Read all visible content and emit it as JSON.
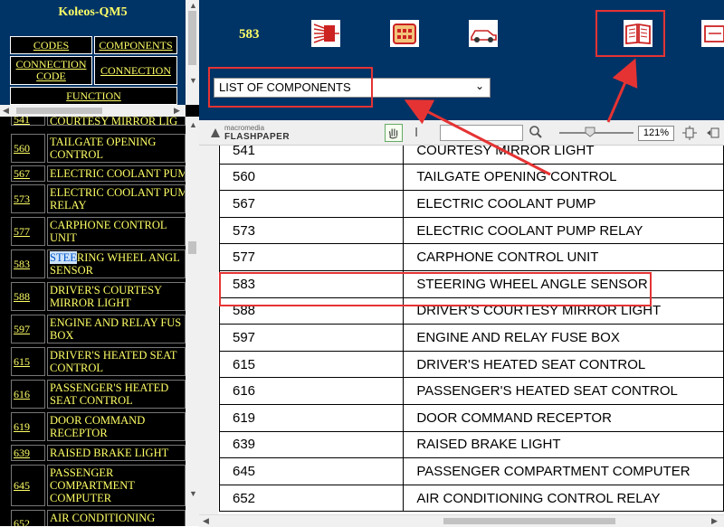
{
  "left_panel": {
    "title": "Koleos-QM5",
    "menu": {
      "codes": "CODES",
      "components": "COMPONENTS",
      "connection_code": "CONNECTION\nCODE",
      "connection": "CONNECTION",
      "function": "FUNCTION"
    },
    "list": [
      {
        "code": "541",
        "label": "COURTESY MIRROR LIG"
      },
      {
        "code": "560",
        "label": "TAILGATE OPENING\nCONTROL"
      },
      {
        "code": "567",
        "label": "ELECTRIC COOLANT PUM"
      },
      {
        "code": "573",
        "label": "ELECTRIC COOLANT PUM\nRELAY"
      },
      {
        "code": "577",
        "label": "CARPHONE CONTROL\nUNIT"
      },
      {
        "code": "583",
        "label_highlight": "STEE",
        "label_rest": "RING WHEEL ANGL",
        "label_line2": "SENSOR"
      },
      {
        "code": "588",
        "label": "DRIVER'S COURTESY\nMIRROR LIGHT"
      },
      {
        "code": "597",
        "label": "ENGINE AND RELAY FUS\nBOX"
      },
      {
        "code": "615",
        "label": "DRIVER'S HEATED SEAT\nCONTROL"
      },
      {
        "code": "616",
        "label": "PASSENGER'S HEATED\nSEAT CONTROL"
      },
      {
        "code": "619",
        "label": "DOOR COMMAND\nRECEPTOR"
      },
      {
        "code": "639",
        "label": "RAISED BRAKE LIGHT"
      },
      {
        "code": "645",
        "label": "PASSENGER\nCOMPARTMENT\nCOMPUTER"
      },
      {
        "code": "652",
        "label": "AIR CONDITIONING"
      }
    ]
  },
  "topbar": {
    "code": "583",
    "select": {
      "value": "LIST OF COMPONENTS"
    },
    "icons": [
      "wiring-icon",
      "connector-icon",
      "car-icon",
      "book-icon",
      "page-icon"
    ]
  },
  "flashpaper": {
    "brand_top": "macromedia",
    "brand_main": "FLASHPAPER",
    "zoom": "121%"
  },
  "components_table": {
    "rows": [
      [
        "541",
        "COURTESY MIRROR LIGHT"
      ],
      [
        "560",
        "TAILGATE OPENING CONTROL"
      ],
      [
        "567",
        "ELECTRIC COOLANT PUMP"
      ],
      [
        "573",
        "ELECTRIC COOLANT PUMP RELAY"
      ],
      [
        "577",
        "CARPHONE CONTROL UNIT"
      ],
      [
        "583",
        "STEERING WHEEL ANGLE SENSOR"
      ],
      [
        "588",
        "DRIVER'S COURTESY MIRROR LIGHT"
      ],
      [
        "597",
        "ENGINE AND RELAY FUSE BOX"
      ],
      [
        "615",
        "DRIVER'S HEATED SEAT CONTROL"
      ],
      [
        "616",
        "PASSENGER'S HEATED SEAT CONTROL"
      ],
      [
        "619",
        "DOOR COMMAND RECEPTOR"
      ],
      [
        "639",
        "RAISED BRAKE LIGHT"
      ],
      [
        "645",
        "PASSENGER COMPARTMENT COMPUTER"
      ],
      [
        "652",
        "AIR CONDITIONING CONTROL RELAY"
      ]
    ]
  },
  "colors": {
    "navy": "#003366",
    "yellow": "#ffff66",
    "annotation_red": "#e53333"
  }
}
